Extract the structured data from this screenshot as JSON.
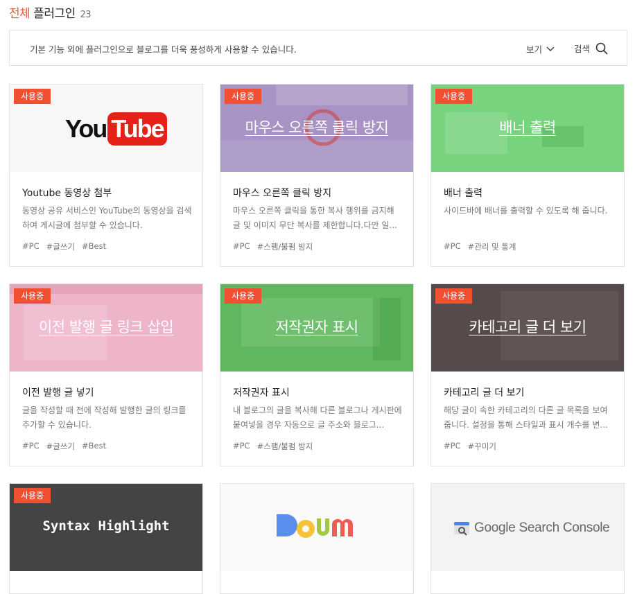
{
  "header": {
    "accent": "전체",
    "title": "플러그인",
    "count": "23"
  },
  "description": {
    "text": "기본 기능 외에 플러그인으로 블로그를 더욱 풍성하게 사용할 수 있습니다.",
    "view_label": "보기",
    "search_label": "검색"
  },
  "cards": [
    {
      "badge": "사용중",
      "thumb_title": "",
      "name": "Youtube 동영상 첨부",
      "desc": "동영상 공유 서비스인 YouTube의 동영상을 검색하여 게시글에 첨부할 수 있습니다.",
      "tags": [
        "#PC",
        "#글쓰기",
        "#Best"
      ]
    },
    {
      "badge": "사용중",
      "thumb_title": "마우스 오른쪽 클릭 방지",
      "name": "마우스 오른쪽 클릭 방지",
      "desc": "마우스 오른쪽 클릭을 통한 복사 행위를 금지해 글 및 이미지 무단 복사를 제한합니다.다만 일...",
      "tags": [
        "#PC",
        "#스팸/불펌 방지"
      ]
    },
    {
      "badge": "사용중",
      "thumb_title": "배너 출력",
      "name": "배너 출력",
      "desc": "사이드바에 배너를 출력할 수 있도록 해 줍니다.",
      "tags": [
        "#PC",
        "#관리 및 통계"
      ]
    },
    {
      "badge": "사용중",
      "thumb_title": "이전 발행 글 링크 삽입",
      "name": "이전 발행 글 넣기",
      "desc": "글을 작성할 때 전에 작성해 발행한 글의 링크를 추가할 수 있습니다.",
      "tags": [
        "#PC",
        "#글쓰기",
        "#Best"
      ]
    },
    {
      "badge": "사용중",
      "thumb_title": "저작권자 표시",
      "name": "저작권자 표시",
      "desc": "내 블로그의 글을 복사해 다른 블로그나 게시판에 붙여넣을 경우 자동으로 글 주소와 블로그...",
      "tags": [
        "#PC",
        "#스팸/불펌 방지"
      ]
    },
    {
      "badge": "사용중",
      "thumb_title": "카테고리 글 더 보기",
      "name": "카테고리 글 더 보기",
      "desc": "해당 글이 속한 카테고리의 다른 글 목록을 보여줍니다. 설정을 통해 스타일과 표시 개수를 변...",
      "tags": [
        "#PC",
        "#꾸미기"
      ]
    },
    {
      "badge": "사용중",
      "thumb_title": "Syntax Highlight",
      "name": "",
      "desc": "",
      "tags": []
    },
    {
      "badge": "",
      "thumb_title": "Daum",
      "name": "",
      "desc": "",
      "tags": []
    },
    {
      "badge": "",
      "thumb_title": "Google Search Console",
      "name": "",
      "desc": "",
      "tags": []
    }
  ],
  "logos": {
    "youtube_left": "You",
    "youtube_right": "Tube"
  },
  "colors": {
    "accent": "#ef5a3a",
    "badge": "#f25033",
    "purple": "#a893c4",
    "green": "#78d37f",
    "pink": "#eeb4c9",
    "green2": "#5fb85f",
    "brown": "#574a4a",
    "dark": "#444444"
  }
}
